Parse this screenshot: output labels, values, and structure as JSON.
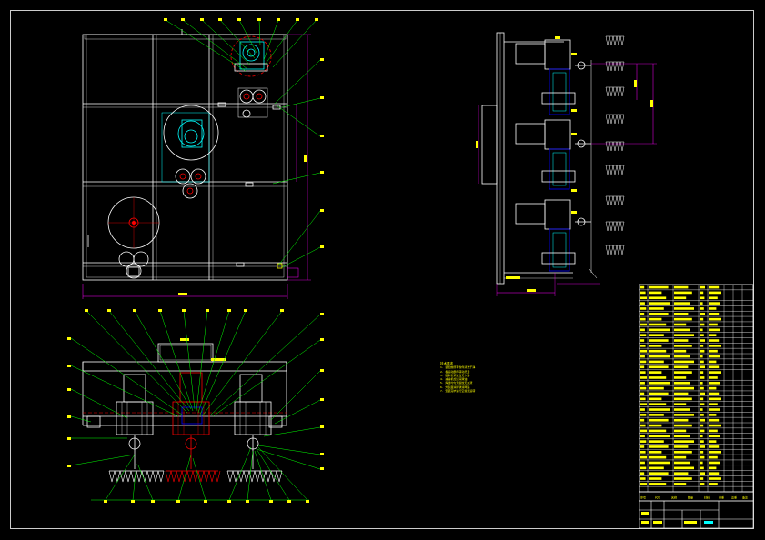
{
  "drawing": {
    "title": "",
    "notes_heading": "技术要求",
    "notes": [
      "1. 装配前所有零件清洗干净",
      "2. 各运动部件转动灵活",
      "3. 链条张紧适当无卡滞",
      "4. 减速机加注润滑油",
      "5. 焊缝均匀无裂纹无夹渣",
      "6. 外表面涂防锈漆两遍",
      "7. 安装完毕进行空载试运转"
    ]
  },
  "colors": {
    "background": "#000000",
    "frame": "#00ff00",
    "outline": "#ffffff",
    "dimension": "#ff00ff",
    "detail": "#00ffff",
    "center": "#ff0000",
    "note": "#ffff00",
    "leader": "#00ff00",
    "text": "#ffff00",
    "hatch": "#0000ff"
  },
  "parts_list": {
    "row_count": 38,
    "header_row": [
      "序号",
      "代号",
      "名称",
      "数量",
      "材料",
      "单重",
      "总重",
      "备注"
    ]
  },
  "title_block": {
    "cells": [
      "",
      "",
      "",
      "",
      ""
    ]
  }
}
